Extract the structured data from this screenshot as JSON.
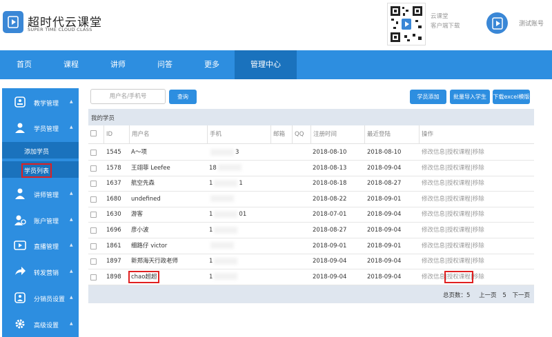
{
  "brand": {
    "title": "超时代云课堂",
    "subtitle": "SUPER TIME CLOUD CLASS",
    "color": "#2d8ee0"
  },
  "header": {
    "download_line1": "云课堂",
    "download_line2": "客户端下载",
    "account": "测试账号"
  },
  "nav": {
    "items": [
      "首页",
      "课程",
      "讲师",
      "问答",
      "更多",
      "管理中心"
    ],
    "active": "管理中心"
  },
  "sidebar": {
    "groups": [
      {
        "label": "教学管理",
        "icon": "teaching-icon"
      },
      {
        "label": "学员管理",
        "icon": "student-icon"
      },
      {
        "label": "讲师管理",
        "icon": "teacher-icon"
      },
      {
        "label": "账户管理",
        "icon": "account-icon"
      },
      {
        "label": "直播管理",
        "icon": "live-icon"
      },
      {
        "label": "转发营销",
        "icon": "share-icon"
      },
      {
        "label": "分销员设置",
        "icon": "distributor-icon"
      },
      {
        "label": "高级设置",
        "icon": "gear-icon"
      }
    ],
    "sub_items": [
      "添加学员",
      "学员列表"
    ],
    "selected_sub": "学员列表"
  },
  "toolbar": {
    "search_placeholder": "用户名/手机号",
    "search_button": "查询",
    "add_button": "学员添加",
    "import_button": "批量导入学生",
    "download_button": "下载excel模版"
  },
  "table": {
    "title": "我的学员",
    "columns": [
      "ID",
      "用户名",
      "手机",
      "邮箱",
      "QQ",
      "注册时间",
      "最近登陆",
      "操作"
    ],
    "rows": [
      {
        "id": "1545",
        "name": "A～项",
        "phone_pre": "",
        "phone_suf": "3",
        "reg": "2018-08-10",
        "last": "2018-08-10"
      },
      {
        "id": "1578",
        "name": "王翊菲 Leefee",
        "phone_pre": "18",
        "phone_suf": "",
        "reg": "2018-08-13",
        "last": "2018-09-04"
      },
      {
        "id": "1637",
        "name": "航空先森",
        "phone_pre": "1",
        "phone_suf": "1",
        "reg": "2018-08-18",
        "last": "2018-08-27"
      },
      {
        "id": "1680",
        "name": "undefined",
        "phone_pre": "",
        "phone_suf": "",
        "reg": "2018-08-22",
        "last": "2018-09-01"
      },
      {
        "id": "1630",
        "name": "游客",
        "phone_pre": "1",
        "phone_suf": "01",
        "reg": "2018-07-01",
        "last": "2018-09-04"
      },
      {
        "id": "1696",
        "name": "彦小波",
        "phone_pre": "1",
        "phone_suf": "",
        "reg": "2018-08-27",
        "last": "2018-09-04"
      },
      {
        "id": "1861",
        "name": "细路仔 victor",
        "phone_pre": "",
        "phone_suf": "",
        "reg": "2018-09-01",
        "last": "2018-09-01"
      },
      {
        "id": "1897",
        "name": "新郑海天行政老师",
        "phone_pre": "1",
        "phone_suf": "",
        "reg": "2018-09-04",
        "last": "2018-09-04"
      },
      {
        "id": "1898",
        "name": "chao超超",
        "phone_pre": "1",
        "phone_suf": "",
        "reg": "2018-09-04",
        "last": "2018-09-04"
      }
    ],
    "op_edit": "修改信息",
    "op_auth": "授权课程",
    "op_remove": "移除",
    "sep": "|"
  },
  "pager": {
    "total_label": "总页数：5",
    "prev": "上一页",
    "current": "5",
    "next": "下一页"
  }
}
